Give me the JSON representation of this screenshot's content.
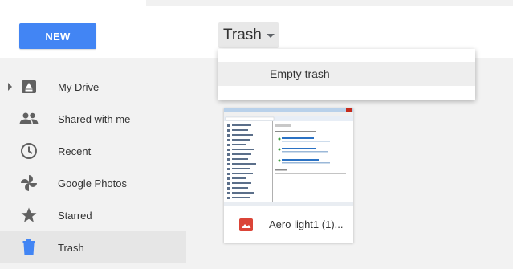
{
  "header": {
    "new_button_label": "NEW",
    "location_title": "Trash"
  },
  "location_menu": {
    "items": [
      {
        "label": "Empty trash"
      }
    ]
  },
  "sidebar": {
    "items": [
      {
        "label": "My Drive",
        "icon": "drive-icon",
        "expandable": true,
        "active": false
      },
      {
        "label": "Shared with me",
        "icon": "people-icon",
        "active": false
      },
      {
        "label": "Recent",
        "icon": "clock-icon",
        "active": false
      },
      {
        "label": "Google Photos",
        "icon": "pinwheel-icon",
        "active": false
      },
      {
        "label": "Starred",
        "icon": "star-icon",
        "active": false
      },
      {
        "label": "Trash",
        "icon": "trash-icon",
        "active": true
      }
    ]
  },
  "files": [
    {
      "name": "Aero light1 (1)...",
      "type_icon": "image-file-icon",
      "thumbnail": "window-screenshot"
    }
  ],
  "colors": {
    "accent": "#4285f4",
    "trash_icon": "#4285f4",
    "image_file_icon": "#db4437",
    "sidebar_icon": "#616161"
  }
}
